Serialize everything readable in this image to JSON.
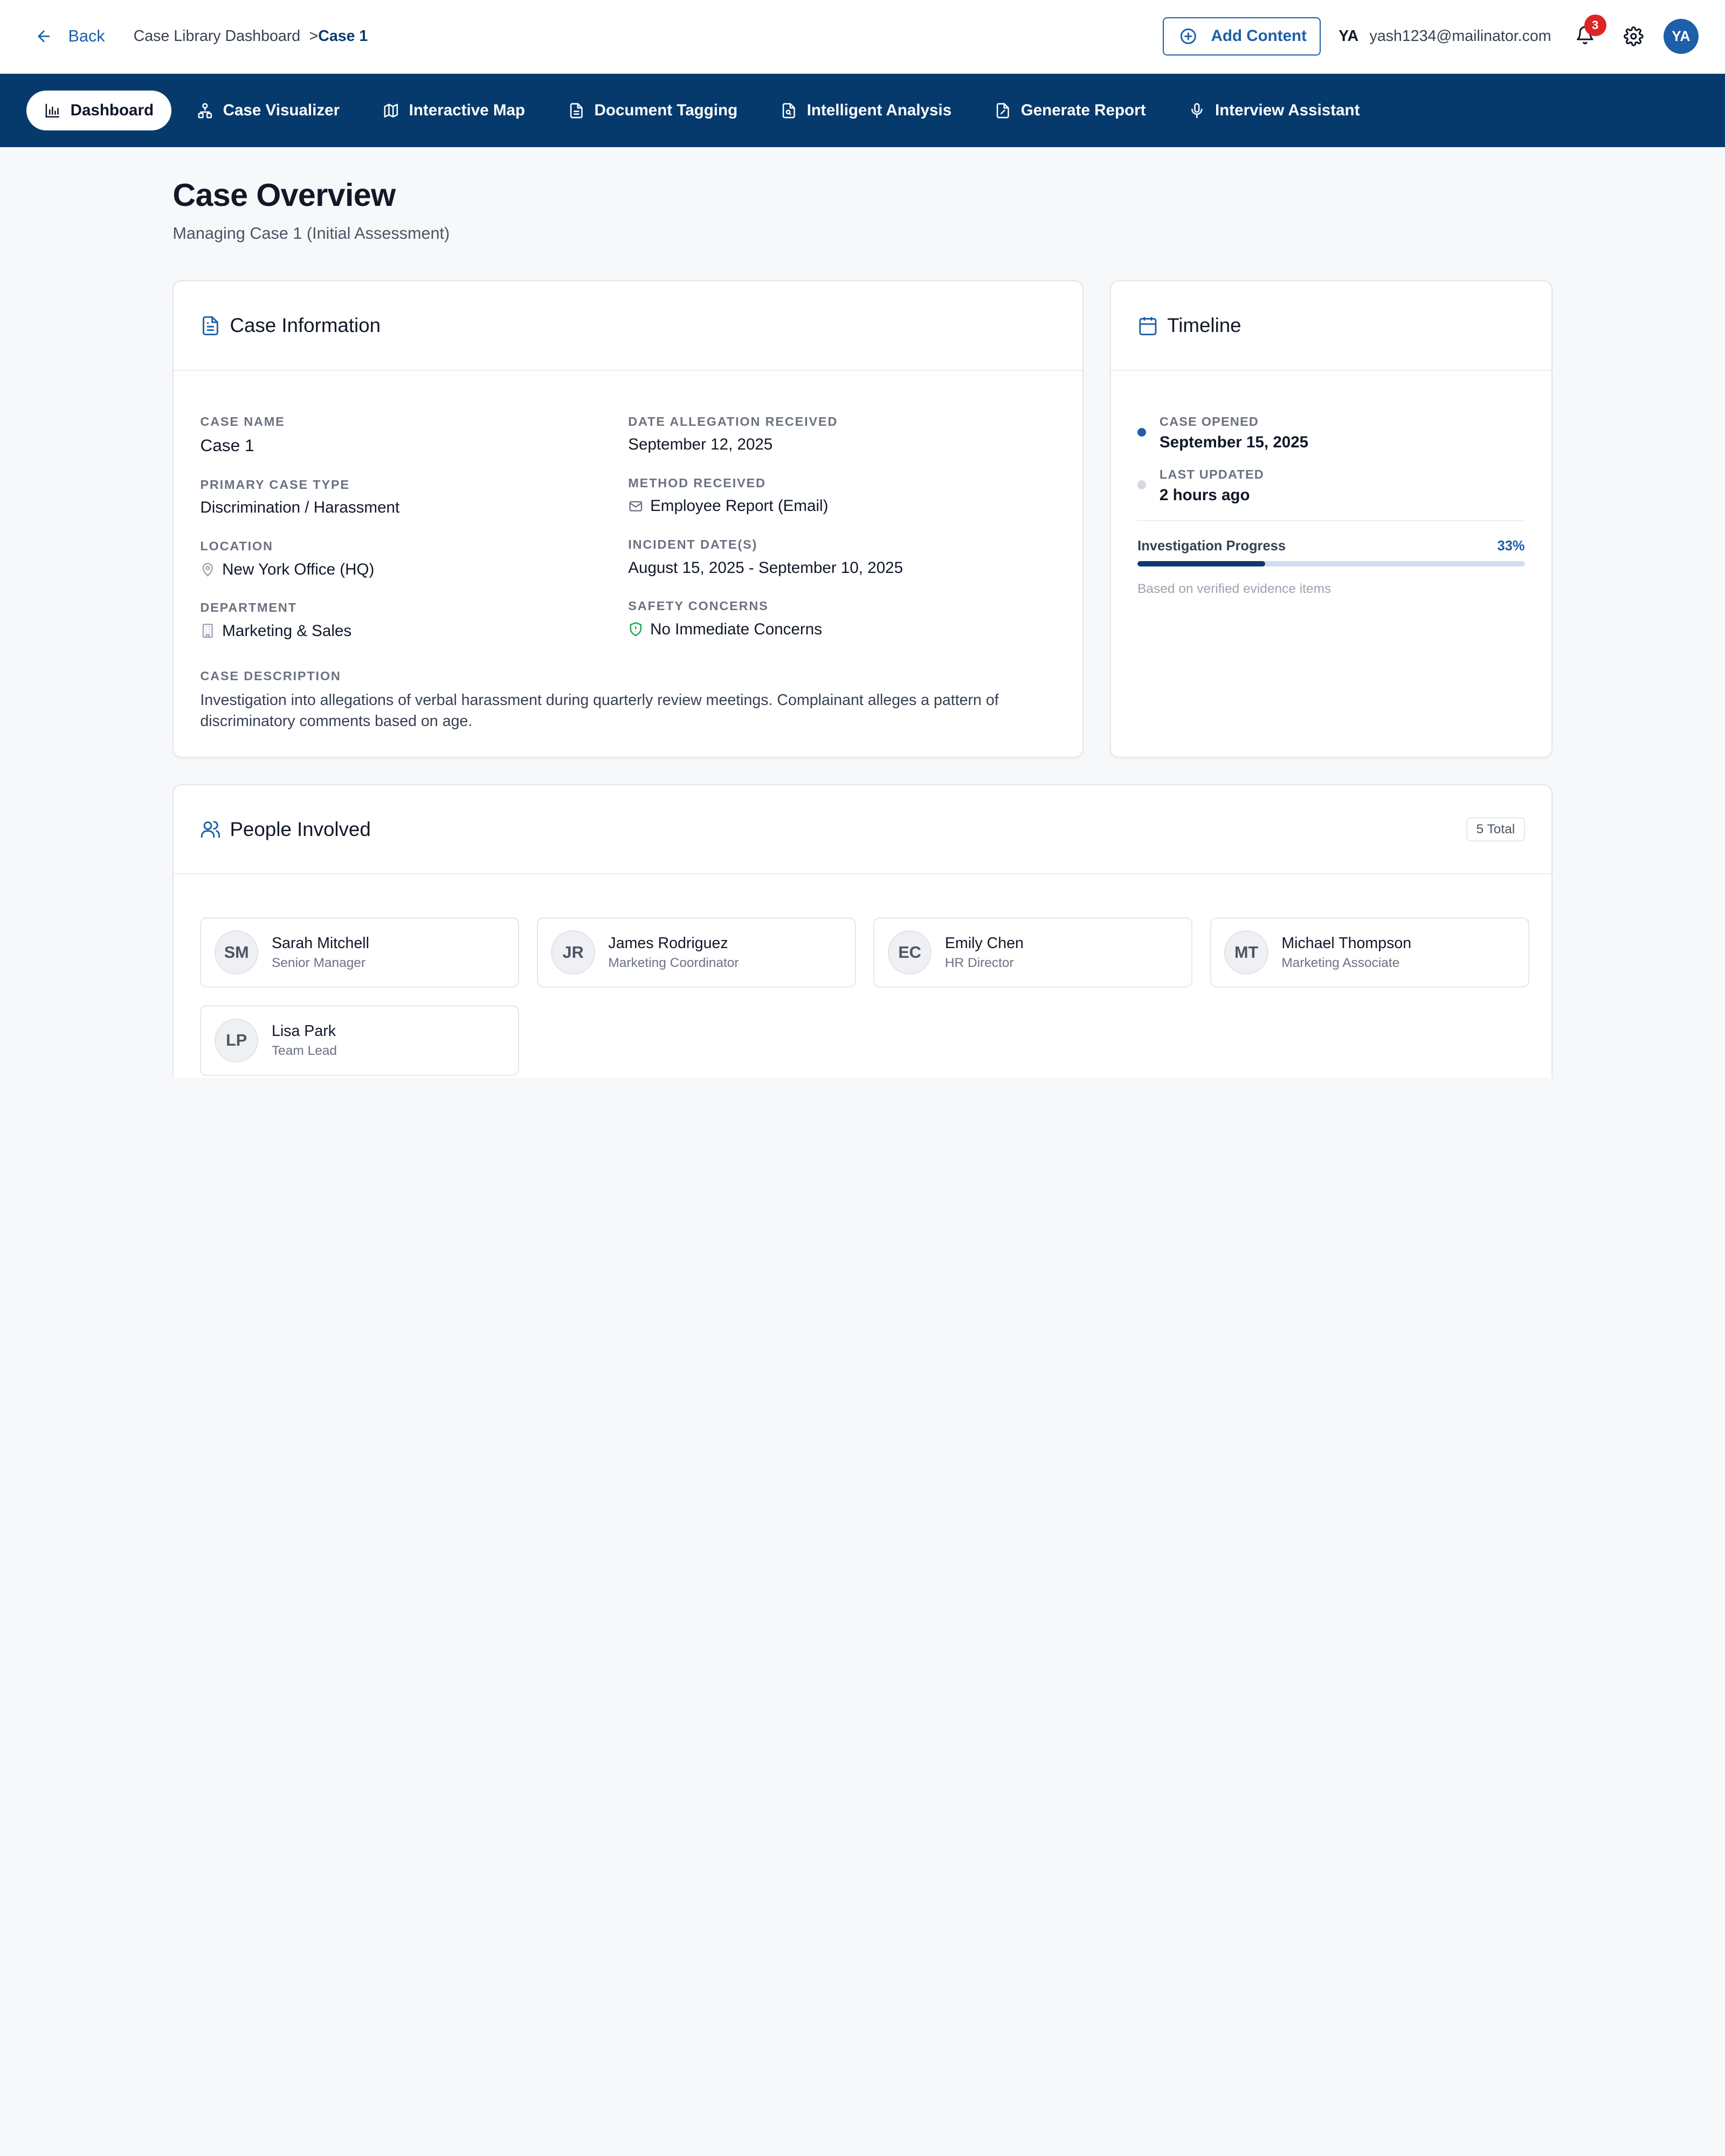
{
  "header": {
    "back_label": "Back",
    "breadcrumb": {
      "root": "Case Library Dashboard",
      "separator": ">",
      "current": "Case 1"
    },
    "add_content_label": "Add Content",
    "user_initials": "YA",
    "user_email": "yash1234@mailinator.com",
    "notification_count": "3",
    "avatar_initials": "YA"
  },
  "nav": {
    "items": [
      {
        "label": "Dashboard",
        "icon": "bar-chart-icon",
        "active": true
      },
      {
        "label": "Case Visualizer",
        "icon": "network-icon",
        "active": false
      },
      {
        "label": "Interactive Map",
        "icon": "map-icon",
        "active": false
      },
      {
        "label": "Document Tagging",
        "icon": "document-icon",
        "active": false
      },
      {
        "label": "Intelligent Analysis",
        "icon": "file-search-icon",
        "active": false
      },
      {
        "label": "Generate Report",
        "icon": "file-report-icon",
        "active": false
      },
      {
        "label": "Interview Assistant",
        "icon": "microphone-icon",
        "active": false
      }
    ]
  },
  "page": {
    "title": "Case Overview",
    "subtitle": "Managing Case 1 (Initial Assessment)"
  },
  "case_info": {
    "title": "Case Information",
    "case_name_label": "Case Name",
    "case_name": "Case 1",
    "primary_type_label": "Primary Case Type",
    "primary_type": "Discrimination / Harassment",
    "location_label": "Location",
    "location": "New York Office (HQ)",
    "department_label": "Department",
    "department": "Marketing & Sales",
    "date_received_label": "Date Allegation Received",
    "date_received": "September 12, 2025",
    "method_label": "Method Received",
    "method": "Employee Report (Email)",
    "incident_label": "Incident Date(s)",
    "incident": "August 15, 2025 - September 10, 2025",
    "safety_label": "Safety Concerns",
    "safety": "No Immediate Concerns",
    "description_label": "Case Description",
    "description": "Investigation into allegations of verbal harassment during quarterly review meetings. Complainant alleges a pattern of discriminatory comments based on age."
  },
  "timeline": {
    "title": "Timeline",
    "opened_label": "CASE OPENED",
    "opened": "September 15, 2025",
    "updated_label": "LAST UPDATED",
    "updated": "2 hours ago",
    "progress_label": "Investigation Progress",
    "progress_text": "33%",
    "progress_value": 0.33,
    "progress_note": "Based on verified evidence items"
  },
  "people": {
    "title": "People Involved",
    "count_label": "5 Total",
    "list": [
      {
        "initials": "SM",
        "name": "Sarah Mitchell",
        "role": "Senior Manager"
      },
      {
        "initials": "JR",
        "name": "James Rodriguez",
        "role": "Marketing Coordinator"
      },
      {
        "initials": "EC",
        "name": "Emily Chen",
        "role": "HR Director"
      },
      {
        "initials": "MT",
        "name": "Michael Thompson",
        "role": "Marketing Associate"
      },
      {
        "initials": "LP",
        "name": "Lisa Park",
        "role": "Team Lead"
      }
    ]
  },
  "colors": {
    "brand_navy": "#063a6d",
    "accent_blue": "#1d5fa8",
    "badge_red": "#dc2626",
    "safety_green": "#16a34a"
  }
}
